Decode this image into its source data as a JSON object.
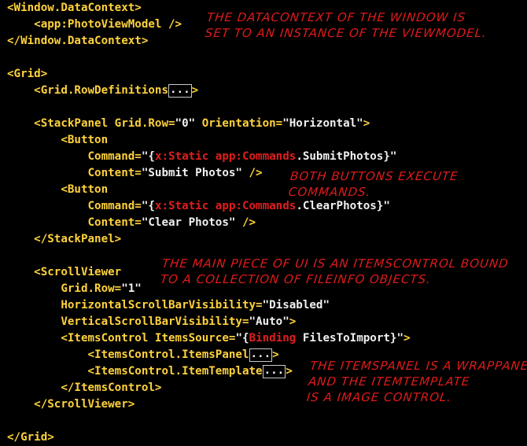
{
  "code_lines": [
    [
      {
        "t": "tag",
        "v": "<Window.DataContext>"
      }
    ],
    [
      {
        "t": "plain",
        "v": "    "
      },
      {
        "t": "tag",
        "v": "<app:PhotoViewModel"
      },
      {
        "t": "plain",
        "v": " "
      },
      {
        "t": "tag",
        "v": "/>"
      }
    ],
    [
      {
        "t": "tag",
        "v": "</Window.DataContext>"
      }
    ],
    [],
    [
      {
        "t": "tag",
        "v": "<Grid>"
      }
    ],
    [
      {
        "t": "plain",
        "v": "    "
      },
      {
        "t": "tag",
        "v": "<Grid.RowDefinitions"
      },
      {
        "t": "collapsed",
        "v": "..."
      },
      {
        "t": "tag",
        "v": ">"
      }
    ],
    [],
    [
      {
        "t": "plain",
        "v": "    "
      },
      {
        "t": "tag",
        "v": "<StackPanel Grid.Row="
      },
      {
        "t": "str",
        "v": "\"0\""
      },
      {
        "t": "tag",
        "v": " Orientation="
      },
      {
        "t": "str",
        "v": "\"Horizontal\""
      },
      {
        "t": "tag",
        "v": ">"
      }
    ],
    [
      {
        "t": "plain",
        "v": "        "
      },
      {
        "t": "tag",
        "v": "<Button"
      }
    ],
    [
      {
        "t": "plain",
        "v": "            "
      },
      {
        "t": "tag",
        "v": "Command="
      },
      {
        "t": "str",
        "v": "\"{"
      },
      {
        "t": "mark",
        "v": "x:Static app:Commands"
      },
      {
        "t": "str",
        "v": ".SubmitPhotos}\""
      }
    ],
    [
      {
        "t": "plain",
        "v": "            "
      },
      {
        "t": "tag",
        "v": "Content="
      },
      {
        "t": "str",
        "v": "\"Submit Photos\""
      },
      {
        "t": "tag",
        "v": " />"
      }
    ],
    [
      {
        "t": "plain",
        "v": "        "
      },
      {
        "t": "tag",
        "v": "<Button"
      }
    ],
    [
      {
        "t": "plain",
        "v": "            "
      },
      {
        "t": "tag",
        "v": "Command="
      },
      {
        "t": "str",
        "v": "\"{"
      },
      {
        "t": "mark",
        "v": "x:Static app:Commands"
      },
      {
        "t": "str",
        "v": ".ClearPhotos}\""
      }
    ],
    [
      {
        "t": "plain",
        "v": "            "
      },
      {
        "t": "tag",
        "v": "Content="
      },
      {
        "t": "str",
        "v": "\"Clear Photos\""
      },
      {
        "t": "tag",
        "v": " />"
      }
    ],
    [
      {
        "t": "plain",
        "v": "    "
      },
      {
        "t": "tag",
        "v": "</StackPanel>"
      }
    ],
    [],
    [
      {
        "t": "plain",
        "v": "    "
      },
      {
        "t": "tag",
        "v": "<ScrollViewer"
      }
    ],
    [
      {
        "t": "plain",
        "v": "        "
      },
      {
        "t": "tag",
        "v": "Grid.Row="
      },
      {
        "t": "str",
        "v": "\"1\""
      }
    ],
    [
      {
        "t": "plain",
        "v": "        "
      },
      {
        "t": "tag",
        "v": "HorizontalScrollBarVisibility="
      },
      {
        "t": "str",
        "v": "\"Disabled\""
      }
    ],
    [
      {
        "t": "plain",
        "v": "        "
      },
      {
        "t": "tag",
        "v": "VerticalScrollBarVisibility="
      },
      {
        "t": "str",
        "v": "\"Auto\""
      },
      {
        "t": "tag",
        "v": ">"
      }
    ],
    [
      {
        "t": "plain",
        "v": "        "
      },
      {
        "t": "tag",
        "v": "<ItemsControl ItemsSource="
      },
      {
        "t": "str",
        "v": "\"{"
      },
      {
        "t": "mark",
        "v": "Binding"
      },
      {
        "t": "str",
        "v": " FilesToImport}\""
      },
      {
        "t": "tag",
        "v": ">"
      }
    ],
    [
      {
        "t": "plain",
        "v": "            "
      },
      {
        "t": "tag",
        "v": "<ItemsControl.ItemsPanel"
      },
      {
        "t": "collapsed",
        "v": "..."
      },
      {
        "t": "tag",
        "v": ">"
      }
    ],
    [
      {
        "t": "plain",
        "v": "            "
      },
      {
        "t": "tag",
        "v": "<ItemsControl.ItemTemplate"
      },
      {
        "t": "collapsed",
        "v": "..."
      },
      {
        "t": "tag",
        "v": ">"
      }
    ],
    [
      {
        "t": "plain",
        "v": "        "
      },
      {
        "t": "tag",
        "v": "</ItemsControl>"
      }
    ],
    [
      {
        "t": "plain",
        "v": "    "
      },
      {
        "t": "tag",
        "v": "</ScrollViewer>"
      }
    ],
    [],
    [
      {
        "t": "tag",
        "v": "</Grid>"
      }
    ]
  ],
  "annotations": {
    "datacontext_note": "The DataContext of the Window is\nset to an instance of the ViewModel.",
    "buttons_note": "Both buttons execute\ncommands.",
    "itemscontrol_note": "The main piece of UI is an ItemsControl bound\nto a collection of FileInfo objects.",
    "itemspanel_note": "The ItemsPanel is a WrapPanel\nand the ItemTemplate\nis a Image control."
  },
  "colors": {
    "background": "#000000",
    "tag": "#ffd23c",
    "string": "#f0f0f0",
    "markup_extension": "#e21d1d",
    "annotation": "#e01b1b"
  }
}
